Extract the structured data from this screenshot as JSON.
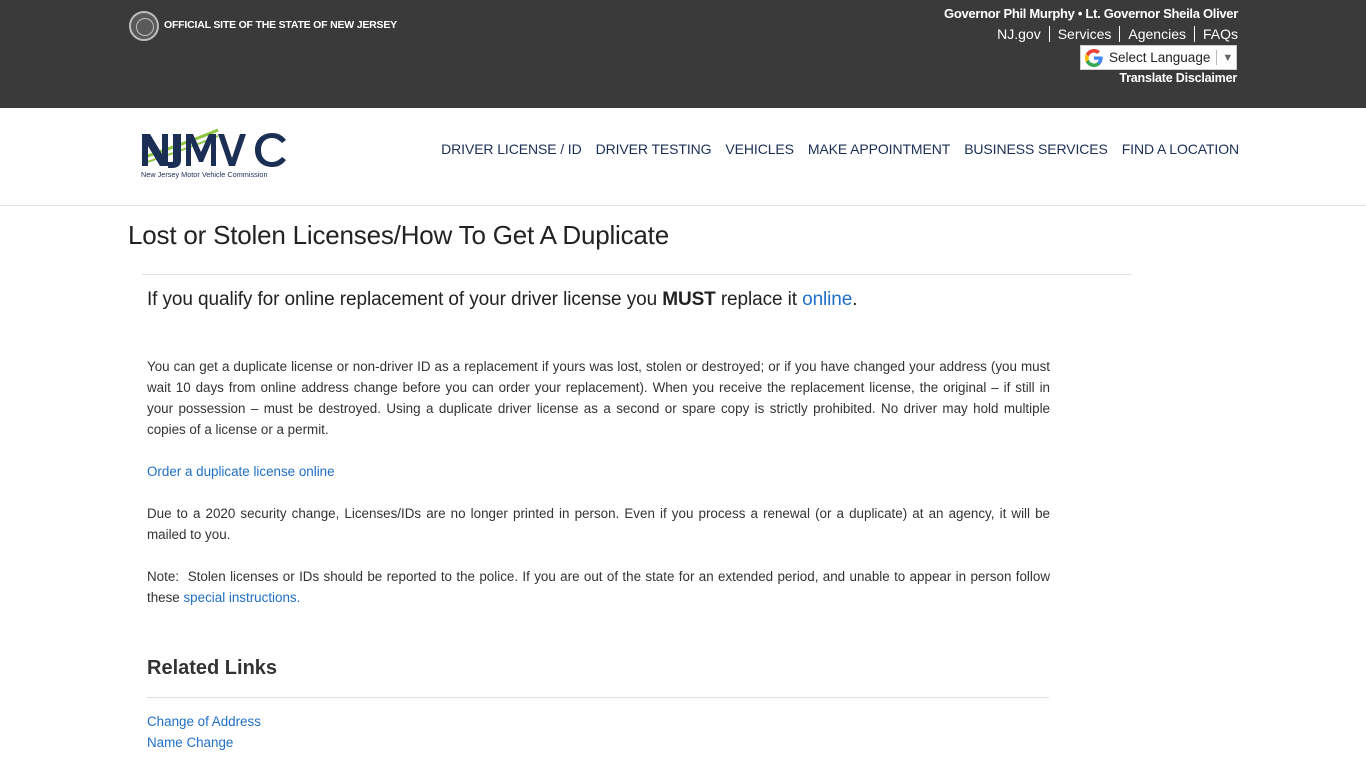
{
  "state_bar": {
    "official": "OFFICIAL SITE OF THE STATE OF NEW JERSEY",
    "governor": "Governor Phil Murphy • Lt. Governor Sheila Oliver",
    "links": [
      "NJ.gov",
      "Services",
      "Agencies",
      "FAQs"
    ],
    "language_select": "Select Language",
    "disclaimer": "Translate Disclaimer"
  },
  "header": {
    "logo_subtitle": "New Jersey Motor Vehicle Commission",
    "nav": [
      "DRIVER LICENSE / ID",
      "DRIVER TESTING",
      "VEHICLES",
      "MAKE APPOINTMENT",
      "BUSINESS SERVICES",
      "FIND A LOCATION"
    ]
  },
  "page": {
    "title": "Lost or Stolen Licenses/How To Get A Duplicate",
    "lead_before": "If you qualify for online replacement of your driver license you ",
    "lead_strong": "MUST",
    "lead_middle": " replace it ",
    "lead_link": "online",
    "lead_after": ".",
    "p1": "You can get a duplicate license or non-driver ID as a replacement if yours was lost, stolen or destroyed; or if you have changed your address (you must wait 10 days from online address change before you can order your replacement). When you receive the replacement license, the original – if still in your possession – must be destroyed. Using a duplicate driver license as a second or spare copy is strictly prohibited. No driver may hold multiple copies of a license or a permit.",
    "order_link": "Order a duplicate license online",
    "p3": "Due to a 2020 security change, Licenses/IDs are no longer printed in person. Even if you process a renewal (or a duplicate) at an agency, it will be mailed to you.",
    "p4_text": "Note:  Stolen licenses or IDs should be reported to the police. If you are out of the state for an extended period, and unable to appear in person follow these ",
    "p4_link": "special instructions."
  },
  "related": {
    "title": "Related Links",
    "links": [
      "Change of Address",
      "Name Change"
    ]
  },
  "colors": {
    "state_bar_bg": "#3a3a3a",
    "nav_text": "#1b2f55",
    "link": "#1f6fc6",
    "logo_navy": "#1b2f55",
    "logo_green": "#8dc63f"
  }
}
